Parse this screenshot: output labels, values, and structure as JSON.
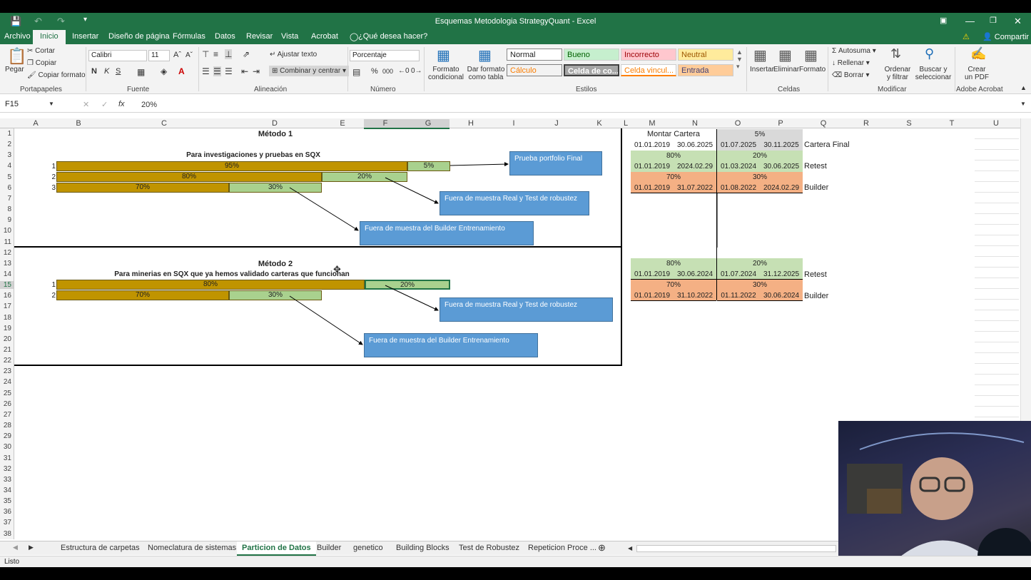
{
  "window": {
    "title": "Esquemas Metodologia StrategyQuant - Excel",
    "share": "Compartir"
  },
  "tabs": [
    "Archivo",
    "Inicio",
    "Insertar",
    "Diseño de página",
    "Fórmulas",
    "Datos",
    "Revisar",
    "Vista",
    "Acrobat"
  ],
  "tell_me": "¿Qué desea hacer?",
  "ribbon": {
    "pegar": "Pegar",
    "cortar": "Cortar",
    "copiar": "Copiar",
    "copiar_formato": "Copiar formato",
    "portapapeles": "Portapapeles",
    "font_name": "Calibri",
    "font_size": "11",
    "fuente": "Fuente",
    "bold": "N",
    "italic": "K",
    "underline": "S",
    "ajustar": "Ajustar texto",
    "combinar": "Combinar y centrar",
    "alineacion": "Alineación",
    "numfmt": "Porcentaje",
    "numero": "Número",
    "pct": "%",
    "thousands": "000",
    "formato_cond": "Formato condicional",
    "dar_formato": "Dar formato como tabla",
    "styles": {
      "normal": "Normal",
      "bueno": "Bueno",
      "incorrecto": "Incorrecto",
      "neutral": "Neutral",
      "calculo": "Cálculo",
      "celda": "Celda de co...",
      "vinculada": "Celda vincul...",
      "entrada": "Entrada"
    },
    "estilos": "Estilos",
    "insertar": "Insertar",
    "eliminar": "Eliminar",
    "formato": "Formato",
    "celdas": "Celdas",
    "autosuma": "Autosuma",
    "rellenar": "Rellenar",
    "borrar": "Borrar",
    "ordenar": "Ordenar y filtrar",
    "buscar": "Buscar y seleccionar",
    "modificar": "Modificar",
    "crear_pdf": "Crear un PDF",
    "adobe": "Adobe Acrobat"
  },
  "formula": {
    "namebox": "F15",
    "fx": "fx",
    "value": "20%"
  },
  "columns": [
    "A",
    "B",
    "C",
    "D",
    "E",
    "F",
    "G",
    "H",
    "I",
    "J",
    "K",
    "L",
    "M",
    "N",
    "O",
    "P",
    "Q",
    "R",
    "S",
    "T",
    "U"
  ],
  "rows": [
    "1",
    "2",
    "3",
    "4",
    "5",
    "6",
    "7",
    "8",
    "9",
    "10",
    "11",
    "12",
    "13",
    "14",
    "15",
    "16",
    "17",
    "18",
    "19",
    "20",
    "21",
    "22",
    "23",
    "24",
    "25",
    "26",
    "27",
    "28",
    "29",
    "30",
    "31",
    "32",
    "33",
    "34",
    "35",
    "36",
    "37",
    "38"
  ],
  "metodo1": {
    "title": "Método 1",
    "subtitle": "Para investigaciones y pruebas en SQX",
    "bars": [
      {
        "n": "1",
        "a": "95%",
        "b": "5%"
      },
      {
        "n": "2",
        "a": "80%",
        "b": "20%"
      },
      {
        "n": "3",
        "a": "70%",
        "b": "30%"
      }
    ],
    "boxes": [
      "Prueba portfolio Final",
      "Fuera de muestra Real y Test de robustez",
      "Fuera de muestra del Builder Entrenamiento"
    ]
  },
  "metodo2": {
    "title": "Método 2",
    "subtitle": "Para minerias en SQX que ya hemos validado carteras que funcionan",
    "bars": [
      {
        "n": "1",
        "a": "80%",
        "b": "20%"
      },
      {
        "n": "2",
        "a": "70%",
        "b": "30%"
      }
    ],
    "boxes": [
      "Fuera de muestra Real y Test de robustez",
      "Fuera de muestra del Builder Entrenamiento"
    ]
  },
  "cartera": {
    "header": "Montar Cartera",
    "r1": {
      "pct": "5%",
      "d1": "01.01.2019",
      "d2": "30.06.2025",
      "d3": "01.07.2025",
      "d4": "30.11.2025",
      "label": "Cartera Final"
    },
    "r2": {
      "p1": "80%",
      "p2": "20%",
      "d1": "01.01.2019",
      "d2": "2024.02.29",
      "d3": "01.03.2024",
      "d4": "30.06.2025",
      "label": "Retest"
    },
    "r3": {
      "p1": "70%",
      "p2": "30%",
      "d1": "01.01.2019",
      "d2": "31.07.2022",
      "d3": "01.08.2022",
      "d4": "2024.02.29",
      "label": "Builder"
    },
    "r4": {
      "p1": "80%",
      "p2": "20%",
      "d1": "01.01.2019",
      "d2": "30.06.2024",
      "d3": "01.07.2024",
      "d4": "31.12.2025",
      "label": "Retest"
    },
    "r5": {
      "p1": "70%",
      "p2": "30%",
      "d1": "01.01.2019",
      "d2": "31.10.2022",
      "d3": "01.11.2022",
      "d4": "30.06.2024",
      "label": "Builder"
    }
  },
  "sheets": [
    "Estructura de carpetas",
    "Nomeclatura de sistemas",
    "Particion de Datos",
    "Builder",
    "genetico",
    "Building Blocks",
    "Test de Robustez",
    "Repeticion Proce ..."
  ],
  "status": "Listo"
}
